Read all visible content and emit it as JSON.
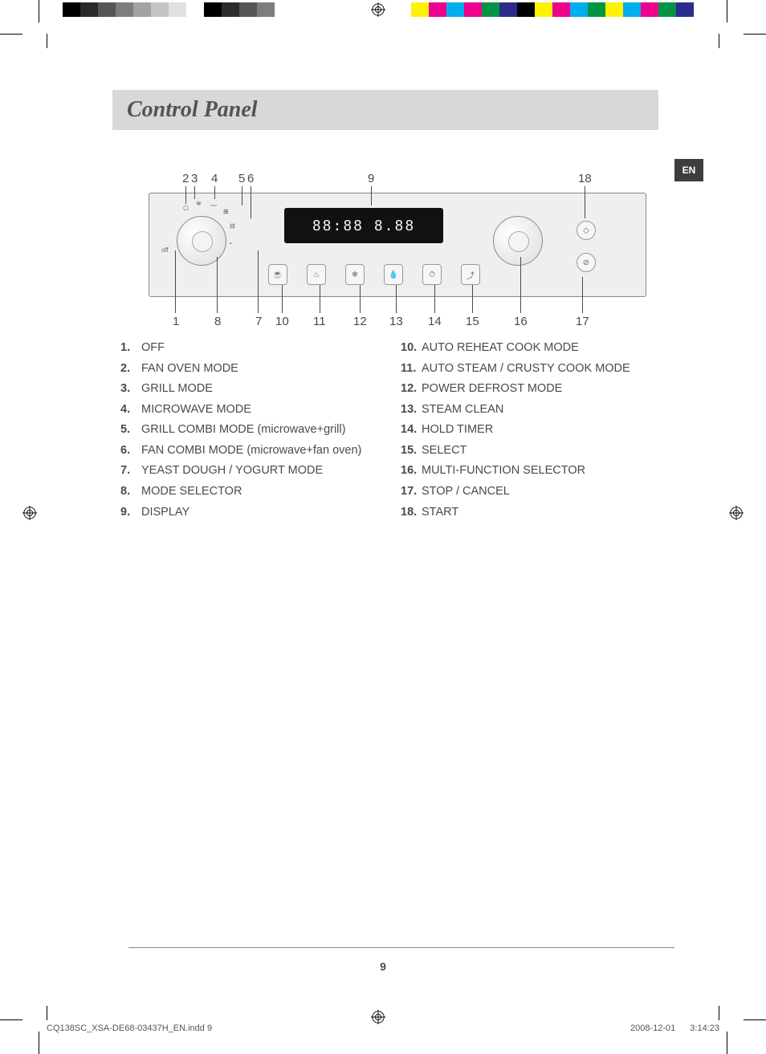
{
  "header": {
    "title": "Control Panel"
  },
  "lang_tab": "EN",
  "page_number": "9",
  "lcd_text": "88:88  8.88",
  "off_label": "off",
  "callouts_top": [
    "2",
    "3",
    "4",
    "5",
    "6",
    "9",
    "18"
  ],
  "callouts_bottom": [
    "1",
    "8",
    "7",
    "10",
    "11",
    "12",
    "13",
    "14",
    "15",
    "16",
    "17"
  ],
  "legend_left": [
    {
      "n": "1.",
      "t": "OFF"
    },
    {
      "n": "2.",
      "t": "FAN OVEN MODE"
    },
    {
      "n": "3.",
      "t": "GRILL MODE"
    },
    {
      "n": "4.",
      "t": "MICROWAVE MODE"
    },
    {
      "n": "5.",
      "t": "GRILL COMBI MODE (microwave+grill)"
    },
    {
      "n": "6.",
      "t": "FAN COMBI MODE (microwave+fan oven)"
    },
    {
      "n": "7.",
      "t": "YEAST DOUGH / YOGURT MODE"
    },
    {
      "n": "8.",
      "t": "MODE SELECTOR"
    },
    {
      "n": "9.",
      "t": "DISPLAY"
    }
  ],
  "legend_right": [
    {
      "n": "10.",
      "t": "AUTO REHEAT COOK MODE"
    },
    {
      "n": "11.",
      "t": "AUTO STEAM / CRUSTY COOK MODE"
    },
    {
      "n": "12.",
      "t": "POWER DEFROST MODE"
    },
    {
      "n": "13.",
      "t": "STEAM CLEAN"
    },
    {
      "n": "14.",
      "t": "HOLD TIMER"
    },
    {
      "n": "15.",
      "t": "SELECT"
    },
    {
      "n": "16.",
      "t": "MULTI-FUNCTION SELECTOR"
    },
    {
      "n": "17.",
      "t": "STOP / CANCEL"
    },
    {
      "n": "18.",
      "t": "START"
    }
  ],
  "slug": {
    "file": "CQ138SC_XSA-DE68-03437H_EN.indd   9",
    "date": "2008-12-01",
    "time": "3:14:23"
  },
  "colorbar_left": [
    "#000",
    "#2b2b2b",
    "#555",
    "#7d7d7d",
    "#a3a3a3",
    "#c4c4c4",
    "#e1e1e1",
    "#fff",
    "#000",
    "#2b2b2b",
    "#555",
    "#7d7d7d",
    "#fff"
  ],
  "colorbar_right": [
    "#fff200",
    "#ec008c",
    "#00aeef",
    "#ec008c",
    "#009444",
    "#2b2b8c",
    "#000",
    "#fff200",
    "#ec008c",
    "#00aeef",
    "#009444",
    "#fff200",
    "#00aeef",
    "#ec008c",
    "#009444",
    "#2b2b8c"
  ]
}
